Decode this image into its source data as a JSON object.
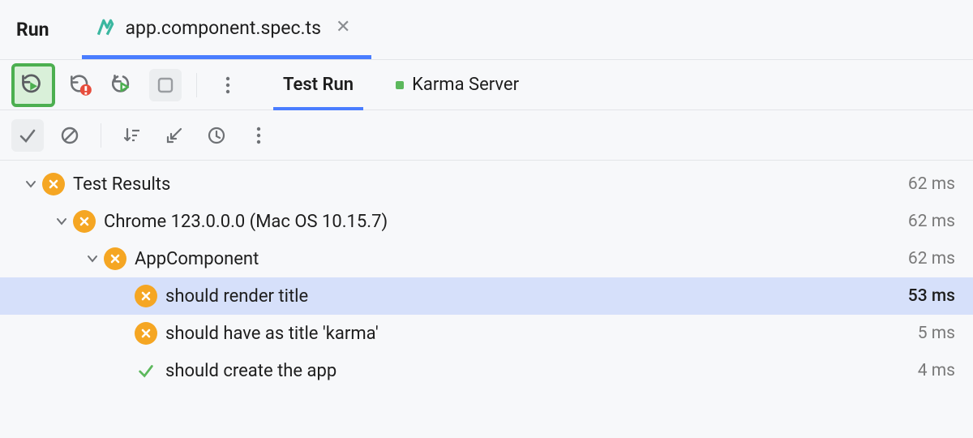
{
  "panel_title": "Run",
  "file_tab": {
    "label": "app.component.spec.ts",
    "icon": "karma-file-icon"
  },
  "toolbar1": {
    "rerun_icon": "rerun-icon",
    "rerun_failed_icon": "rerun-failed-icon",
    "toggle_auto_icon": "toggle-auto-test-icon",
    "stop_icon": "stop-icon",
    "more_icon": "more-vertical-icon",
    "tabs": [
      {
        "label": "Test Run",
        "active": true
      },
      {
        "label": "Karma Server",
        "active": false,
        "has_dot": true
      }
    ]
  },
  "toolbar2": {
    "show_passed_icon": "check-icon",
    "show_ignored_icon": "circle-slash-icon",
    "sort_icon": "sort-icon",
    "import_icon": "import-icon",
    "history_icon": "history-icon",
    "more_icon": "more-vertical-icon"
  },
  "tree": [
    {
      "depth": 0,
      "expandable": true,
      "expanded": true,
      "status": "fail",
      "label": "Test Results",
      "time": "62 ms",
      "selected": false
    },
    {
      "depth": 1,
      "expandable": true,
      "expanded": true,
      "status": "fail",
      "label": "Chrome 123.0.0.0 (Mac OS 10.15.7)",
      "time": "62 ms",
      "selected": false
    },
    {
      "depth": 2,
      "expandable": true,
      "expanded": true,
      "status": "fail",
      "label": "AppComponent",
      "time": "62 ms",
      "selected": false
    },
    {
      "depth": 3,
      "expandable": false,
      "status": "fail",
      "label": "should render title",
      "time": "53 ms",
      "selected": true
    },
    {
      "depth": 3,
      "expandable": false,
      "status": "fail",
      "label": "should have as title 'karma'",
      "time": "5 ms",
      "selected": false
    },
    {
      "depth": 3,
      "expandable": false,
      "status": "pass",
      "label": "should create the app",
      "time": "4 ms",
      "selected": false
    }
  ]
}
